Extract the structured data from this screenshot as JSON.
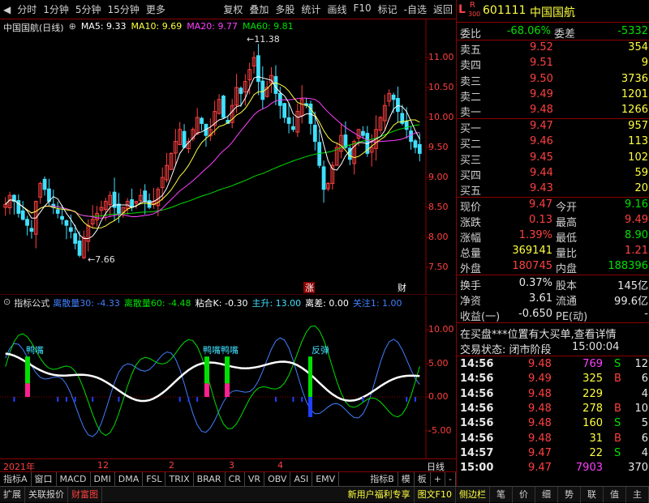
{
  "toolbar": {
    "back_icon": "left-triangle-icon",
    "left_items": [
      "分时",
      "1分钟",
      "5分钟",
      "15分钟",
      "更多"
    ],
    "right_items": [
      "复权",
      "叠加",
      "多股",
      "统计",
      "画线",
      "F10",
      "标记",
      "-自选",
      "返回"
    ]
  },
  "main_chart": {
    "title": "中国国航(日线)",
    "ma": [
      {
        "label": "MA5: 9.33",
        "color": "#ffffff"
      },
      {
        "label": "MA10: 9.69",
        "color": "#ffff40"
      },
      {
        "label": "MA20: 9.77",
        "color": "#ff40ff"
      },
      {
        "label": "MA60: 9.81",
        "color": "#00e000"
      }
    ],
    "high_label": "11.38",
    "low_label": "7.66",
    "y_ticks": [
      "11.00",
      "10.50",
      "10.00",
      "9.50",
      "9.00",
      "8.50",
      "8.00",
      "7.50"
    ],
    "markers": [
      "涨",
      "财"
    ],
    "colors": {
      "up": "#ff4040",
      "down": "#40e0ff",
      "ma5": "#ffffff",
      "ma10": "#ffff40",
      "ma20": "#ff40ff",
      "ma60": "#00e000",
      "border": "#8b0000"
    }
  },
  "indicator": {
    "name": "指标公式",
    "values": [
      {
        "label": "离散量30: -4.33",
        "color": "#4080ff"
      },
      {
        "label": "离散量60: -4.48",
        "color": "#00e000"
      },
      {
        "label": "粘合K: -0.30",
        "color": "#ffffff"
      },
      {
        "label": "主升: 13.00",
        "color": "#40e0ff"
      },
      {
        "label": "离差: 0.00",
        "color": "#ffffff"
      },
      {
        "label": "关注1: 1.00",
        "color": "#4080ff"
      }
    ],
    "y_ticks": [
      "10.00",
      "5.00",
      "0.00",
      "-5.00"
    ],
    "signals": [
      "鸭嘴",
      "鸭嘴鸭嘴",
      "反弹"
    ]
  },
  "x_axis": [
    "2021年",
    "12",
    "2",
    "3",
    "4"
  ],
  "x_axis_end": "日线",
  "bottom_tabs": [
    "指标A",
    "窗口",
    "MACD",
    "DMI",
    "DMA",
    "FSL",
    "TRIX",
    "BRAR",
    "CR",
    "VR",
    "OBV",
    "ASI",
    "EMV"
  ],
  "bottom_right": [
    "指标B",
    "模",
    "板",
    "+",
    "-"
  ],
  "statusbar": {
    "left": [
      "扩展",
      "关联报价",
      "财富图"
    ],
    "right": [
      "新用户福利专享",
      "图文F10",
      "侧边栏",
      "笔",
      "价",
      "细",
      "势",
      "联",
      "值",
      "主"
    ]
  },
  "quote": {
    "badge": "L",
    "badge2": "R",
    "badge_sub": "300",
    "code": "601111",
    "name": "中国国航",
    "wei_bi_label": "委比",
    "wei_bi": "-68.06%",
    "wei_cha_label": "委差",
    "wei_cha": "-5332",
    "asks": [
      {
        "label": "卖五",
        "price": "9.52",
        "vol": "354"
      },
      {
        "label": "卖四",
        "price": "9.51",
        "vol": "9"
      },
      {
        "label": "卖三",
        "price": "9.50",
        "vol": "3736"
      },
      {
        "label": "卖二",
        "price": "9.49",
        "vol": "1201"
      },
      {
        "label": "卖一",
        "price": "9.48",
        "vol": "1266"
      }
    ],
    "bids": [
      {
        "label": "买一",
        "price": "9.47",
        "vol": "957"
      },
      {
        "label": "买二",
        "price": "9.46",
        "vol": "113"
      },
      {
        "label": "买三",
        "price": "9.45",
        "vol": "102"
      },
      {
        "label": "买四",
        "price": "9.44",
        "vol": "59"
      },
      {
        "label": "买五",
        "price": "9.43",
        "vol": "20"
      }
    ],
    "stats": [
      {
        "l1": "现价",
        "v1": "9.47",
        "c1": "red",
        "l2": "今开",
        "v2": "9.16",
        "c2": "green"
      },
      {
        "l1": "涨跌",
        "v1": "0.13",
        "c1": "red",
        "l2": "最高",
        "v2": "9.49",
        "c2": "red"
      },
      {
        "l1": "涨幅",
        "v1": "1.39%",
        "c1": "red",
        "l2": "最低",
        "v2": "8.90",
        "c2": "green"
      },
      {
        "l1": "总量",
        "v1": "369141",
        "c1": "yel",
        "l2": "量比",
        "v2": "1.21",
        "c2": "red"
      },
      {
        "l1": "外盘",
        "v1": "180745",
        "c1": "red",
        "l2": "内盘",
        "v2": "188396",
        "c2": "green"
      }
    ],
    "stats2": [
      {
        "l1": "换手",
        "v1": "0.37%",
        "l2": "股本",
        "v2": "145亿"
      },
      {
        "l1": "净资",
        "v1": "3.61",
        "l2": "流通",
        "v2": "99.6亿"
      },
      {
        "l1": "收益(一)",
        "v1": "-0.650",
        "l2": "PE(动)",
        "v2": "-"
      }
    ],
    "notice": "在买盘***位置有大买单,查看详情",
    "status_label": "交易状态: 闭市阶段",
    "status_time": "15:00:04",
    "ticks": [
      {
        "t": "14:56",
        "p": "9.48",
        "v": "769",
        "vc": "mag",
        "s": "S",
        "sc": "green",
        "n": "12"
      },
      {
        "t": "14:56",
        "p": "9.49",
        "v": "325",
        "vc": "yel",
        "s": "B",
        "sc": "red",
        "n": "6"
      },
      {
        "t": "14:56",
        "p": "9.48",
        "v": "229",
        "vc": "yel",
        "s": "",
        "sc": "green",
        "n": "4"
      },
      {
        "t": "14:56",
        "p": "9.48",
        "v": "278",
        "vc": "yel",
        "s": "B",
        "sc": "red",
        "n": "10"
      },
      {
        "t": "14:56",
        "p": "9.48",
        "v": "160",
        "vc": "yel",
        "s": "S",
        "sc": "green",
        "n": "5"
      },
      {
        "t": "14:56",
        "p": "9.48",
        "v": "31",
        "vc": "yel",
        "s": "B",
        "sc": "red",
        "n": "6"
      },
      {
        "t": "14:57",
        "p": "9.47",
        "v": "22",
        "vc": "yel",
        "s": "S",
        "sc": "green",
        "n": "4"
      },
      {
        "t": "15:00",
        "p": "9.47",
        "v": "7903",
        "vc": "mag",
        "s": "",
        "sc": "green",
        "n": "370"
      }
    ]
  }
}
